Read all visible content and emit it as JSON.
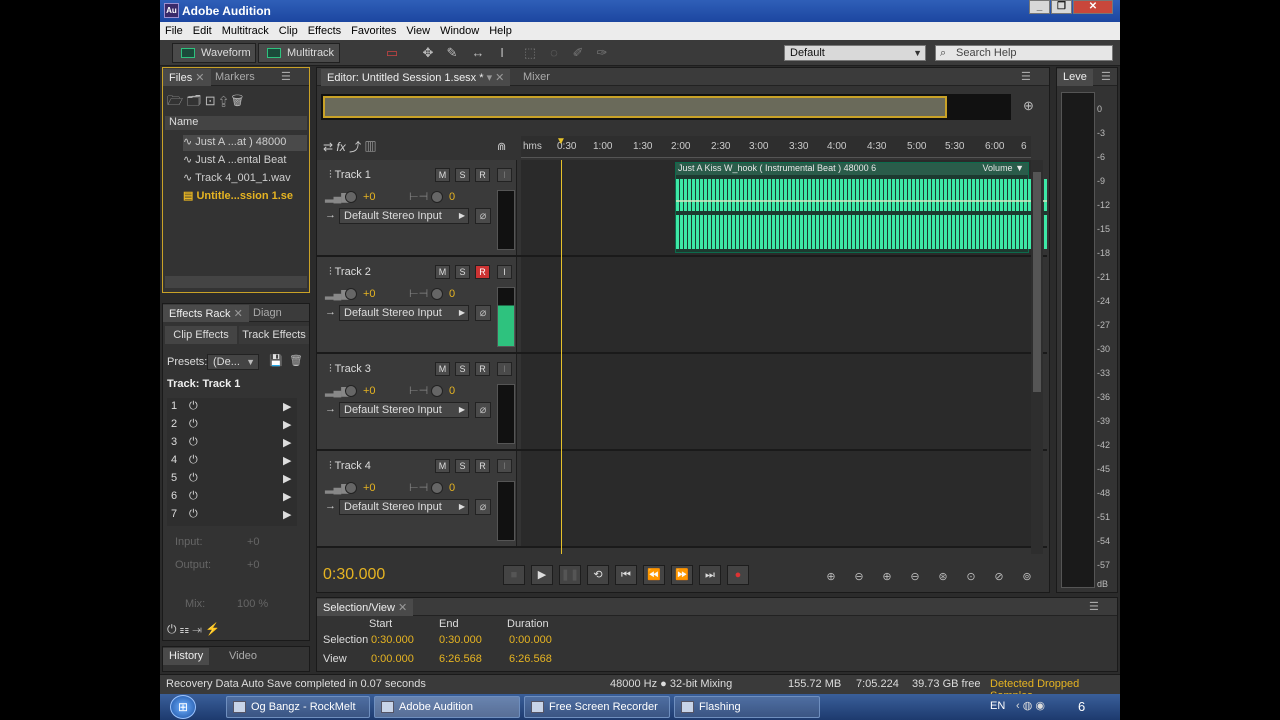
{
  "app": {
    "title": "Adobe Audition",
    "logo": "Au"
  },
  "menu": [
    "File",
    "Edit",
    "Multitrack",
    "Clip",
    "Effects",
    "Favorites",
    "View",
    "Window",
    "Help"
  ],
  "toolbar": {
    "waveform": "Waveform",
    "multitrack": "Multitrack",
    "workspace": "Default",
    "search_placeholder": "Search Help"
  },
  "files_panel": {
    "tabs": [
      "Files",
      "Markers"
    ],
    "header": "Name",
    "items": [
      "Just A ...at ) 48000",
      "Just A ...ental Beat",
      "Track 4_001_1.wav",
      "Untitle...ssion 1.se"
    ]
  },
  "editor": {
    "tab": "Editor: Untitled Session 1.sesx *",
    "mixer": "Mixer",
    "timecode": "0:30.000",
    "ruler": [
      "hms",
      "0:30",
      "1:00",
      "1:30",
      "2:00",
      "2:30",
      "3:00",
      "3:30",
      "4:00",
      "4:30",
      "5:00",
      "5:30",
      "6:00",
      "6"
    ],
    "clip_title": "Just A Kiss W_hook ( Instrumental Beat ) 48000 6",
    "clip_volume": "Volume",
    "tracks": [
      {
        "name": "Track 1",
        "vol": "+0",
        "pan": "0",
        "input": "Default Stereo Input"
      },
      {
        "name": "Track 2",
        "vol": "+0",
        "pan": "0",
        "input": "Default Stereo Input"
      },
      {
        "name": "Track 3",
        "vol": "+0",
        "pan": "0",
        "input": "Default Stereo Input"
      },
      {
        "name": "Track 4",
        "vol": "+0",
        "pan": "0",
        "input": "Default Stereo Input"
      }
    ],
    "msr": [
      "M",
      "S",
      "R",
      "I"
    ]
  },
  "effects_panel": {
    "tabs": [
      "Effects Rack",
      "Diagn"
    ],
    "clip_effects": "Clip Effects",
    "track_effects": "Track Effects",
    "presets_label": "Presets:",
    "presets_value": "(De...",
    "track_label": "Track: Track 1",
    "slots": [
      "1",
      "2",
      "3",
      "4",
      "5",
      "6",
      "7"
    ],
    "input_label": "Input:",
    "input_value": "+0",
    "output_label": "Output:",
    "output_value": "+0",
    "mix_label": "Mix:",
    "mix_value": "100 %"
  },
  "history_panel": {
    "tabs": [
      "History",
      "Video"
    ]
  },
  "selection_panel": {
    "tab": "Selection/View",
    "headers": [
      "Start",
      "End",
      "Duration"
    ],
    "rows": [
      {
        "label": "Selection",
        "start": "0:30.000",
        "end": "0:30.000",
        "duration": "0:00.000"
      },
      {
        "label": "View",
        "start": "0:00.000",
        "end": "6:26.568",
        "duration": "6:26.568"
      }
    ]
  },
  "levels_panel": {
    "tab": "Leve",
    "scale": [
      "0",
      "-3",
      "-6",
      "-9",
      "-12",
      "-15",
      "-18",
      "-21",
      "-24",
      "-27",
      "-30",
      "-33",
      "-36",
      "-39",
      "-42",
      "-45",
      "-48",
      "-51",
      "-54",
      "-57",
      "dB"
    ]
  },
  "status": {
    "message": "Recovery Data Auto Save completed in 0.07 seconds",
    "mix": "48000 Hz ● 32-bit Mixing",
    "mem": "155.72 MB",
    "dur": "7:05.224",
    "disk": "39.73 GB free",
    "dropped": "Detected Dropped Samples"
  },
  "taskbar": {
    "items": [
      "Og Bangz - RockMelt",
      "Adobe Audition",
      "Free Screen Recorder",
      "Flashing"
    ],
    "lang": "EN",
    "clock": "6"
  },
  "playback": {
    "clip_start_fraction": 0.302,
    "playhead_fraction": 0.078
  }
}
